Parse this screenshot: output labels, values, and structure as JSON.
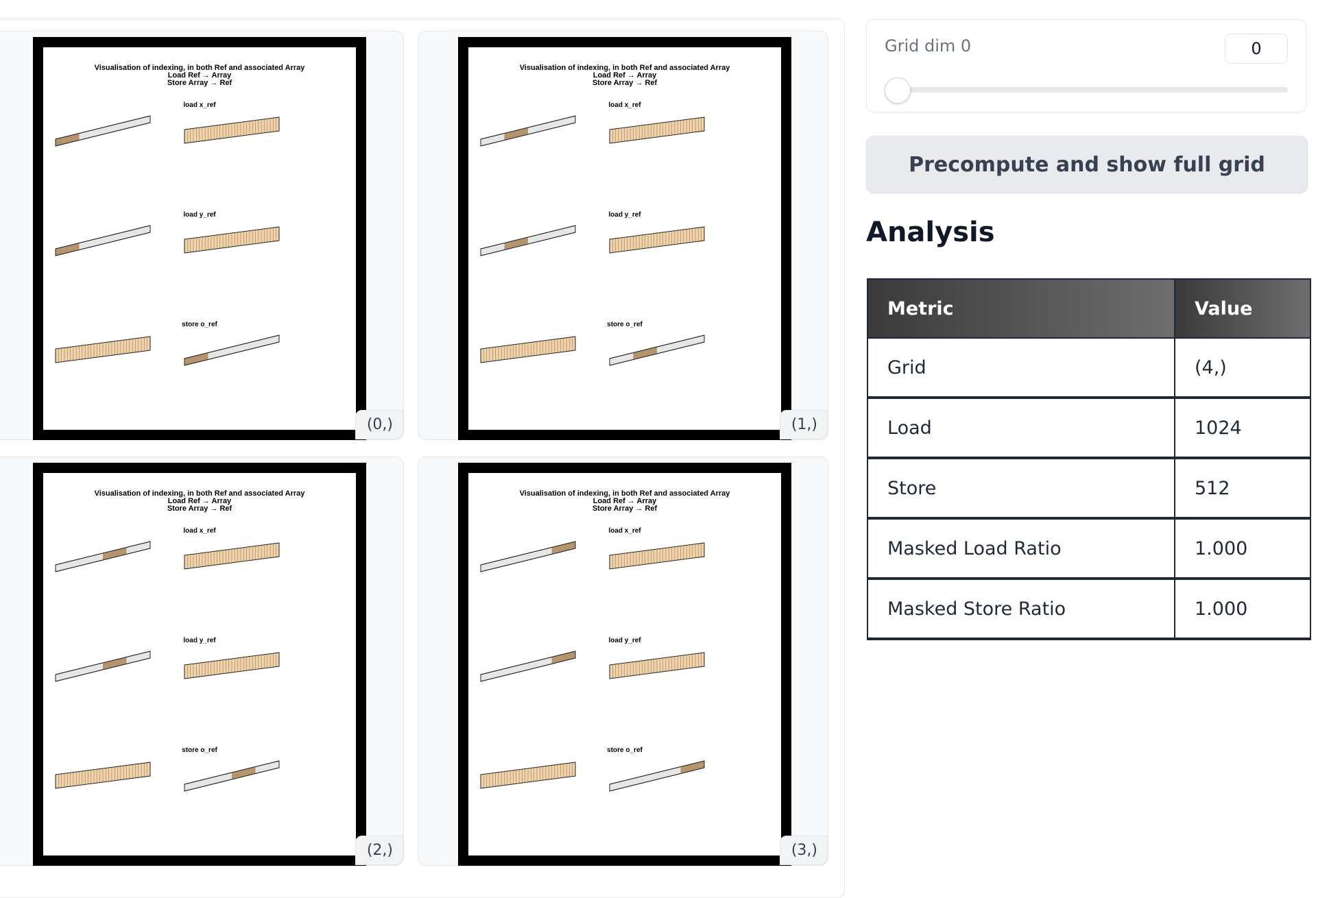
{
  "gallery": {
    "items": [
      {
        "caption": "(0,)",
        "figure": {
          "title": "Visualisation of indexing, in both Ref and associated Array",
          "line2": "Load Ref → Array",
          "line3": "Store Array → Ref",
          "labels": [
            "load x_ref",
            "load y_ref",
            "store o_ref"
          ]
        }
      },
      {
        "caption": "(1,)",
        "figure": {
          "title": "Visualisation of indexing, in both Ref and associated Array",
          "line2": "Load Ref → Array",
          "line3": "Store Array → Ref",
          "labels": [
            "load x_ref",
            "load y_ref",
            "store o_ref"
          ]
        }
      },
      {
        "caption": "(2,)",
        "figure": {
          "title": "Visualisation of indexing, in both Ref and associated Array",
          "line2": "Load Ref → Array",
          "line3": "Store Array → Ref",
          "labels": [
            "load x_ref",
            "load y_ref",
            "store o_ref"
          ]
        }
      },
      {
        "caption": "(3,)",
        "figure": {
          "title": "Visualisation of indexing, in both Ref and associated Array",
          "line2": "Load Ref → Array",
          "line3": "Store Array → Ref",
          "labels": [
            "load x_ref",
            "load y_ref",
            "store o_ref"
          ]
        }
      }
    ]
  },
  "slider": {
    "label": "Grid dim 0",
    "value": "0",
    "level": 0
  },
  "button": {
    "label": "Precompute and show full grid"
  },
  "analysis": {
    "heading": "Analysis",
    "columns": [
      "Metric",
      "Value"
    ],
    "rows": [
      {
        "metric": "Grid",
        "value": "(4,)"
      },
      {
        "metric": "Load",
        "value": "1024"
      },
      {
        "metric": "Store",
        "value": "512"
      },
      {
        "metric": "Masked Load Ratio",
        "value": "1.000"
      },
      {
        "metric": "Masked Store Ratio",
        "value": "1.000"
      }
    ]
  },
  "colors": {
    "highlight": "#b5956e",
    "array_fill": "#f0d2ab",
    "ref_fill": "#e6e6e6"
  }
}
